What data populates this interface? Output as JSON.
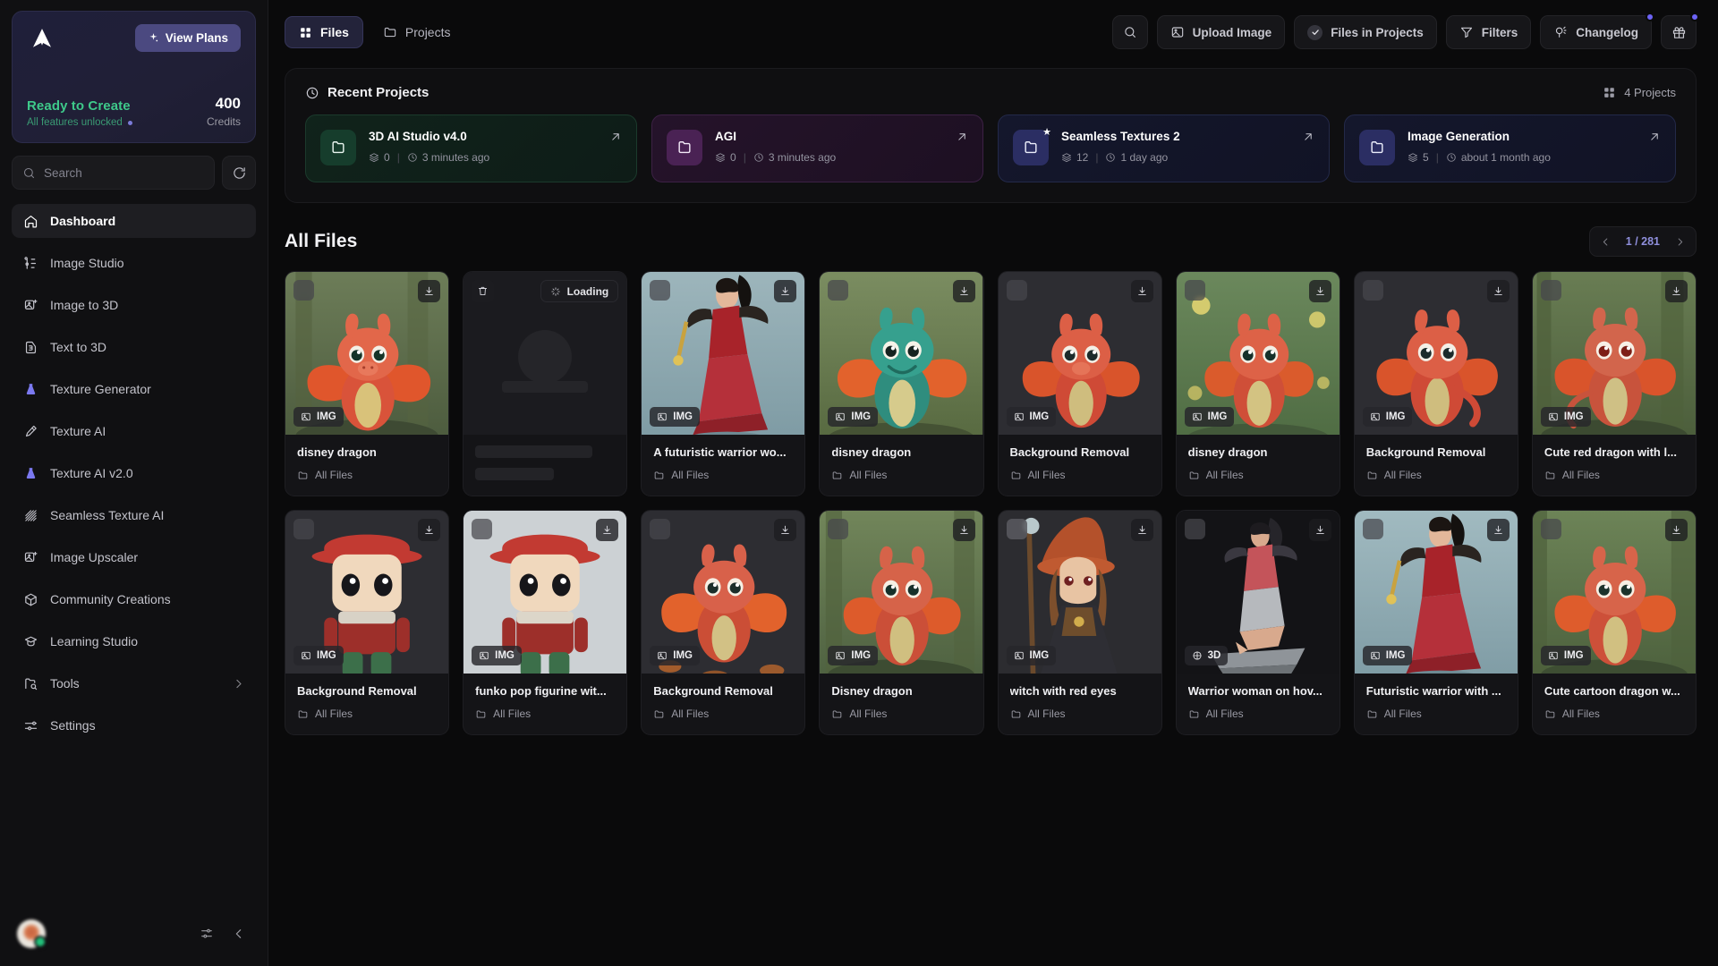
{
  "sidebar": {
    "plan": {
      "view_plans_label": "View Plans",
      "status_title": "Ready to Create",
      "status_sub": "All features unlocked",
      "credits_value": "400",
      "credits_label": "Credits"
    },
    "search_placeholder": "Search",
    "nav_items": [
      {
        "label": "Dashboard",
        "icon": "home-icon",
        "active": true
      },
      {
        "label": "Image Studio",
        "icon": "image-studio-icon",
        "active": false
      },
      {
        "label": "Image to 3D",
        "icon": "image-to-3d-icon",
        "active": false
      },
      {
        "label": "Text to 3D",
        "icon": "text-to-3d-icon",
        "active": false
      },
      {
        "label": "Texture Generator",
        "icon": "texture-generator-icon",
        "active": false
      },
      {
        "label": "Texture AI",
        "icon": "texture-ai-icon",
        "active": false
      },
      {
        "label": "Texture AI v2.0",
        "icon": "texture-ai-v2-icon",
        "active": false
      },
      {
        "label": "Seamless Texture AI",
        "icon": "seamless-texture-icon",
        "active": false
      },
      {
        "label": "Image Upscaler",
        "icon": "image-upscaler-icon",
        "active": false
      },
      {
        "label": "Community Creations",
        "icon": "community-icon",
        "active": false
      },
      {
        "label": "Learning Studio",
        "icon": "learning-icon",
        "active": false
      },
      {
        "label": "Tools",
        "icon": "tools-icon",
        "active": false,
        "chevron": true
      },
      {
        "label": "Settings",
        "icon": "settings-icon",
        "active": false
      }
    ],
    "profile": {
      "name": "",
      "email": ""
    }
  },
  "topbar": {
    "tabs": [
      {
        "label": "Files",
        "icon": "grid-icon",
        "active": true
      },
      {
        "label": "Projects",
        "icon": "folder-icon",
        "active": false
      }
    ],
    "actions": [
      {
        "label": "",
        "icon": "search-icon",
        "icon_only": true,
        "badge": false
      },
      {
        "label": "Upload Image",
        "icon": "image-icon",
        "icon_only": false,
        "badge": false
      },
      {
        "label": "Files in Projects",
        "icon": "check-icon",
        "icon_only": false,
        "badge": false
      },
      {
        "label": "Filters",
        "icon": "funnel-icon",
        "icon_only": false,
        "badge": false
      },
      {
        "label": "Changelog",
        "icon": "megaphone-icon",
        "icon_only": false,
        "badge": true
      },
      {
        "label": "",
        "icon": "gift-icon",
        "icon_only": true,
        "badge": true
      }
    ]
  },
  "recent": {
    "title": "Recent Projects",
    "count_label": "4 Projects",
    "projects": [
      {
        "name": "3D AI Studio v4.0",
        "assets": "0",
        "time": "3 minutes ago",
        "color": "c-green",
        "icon_color": "ico-green",
        "starred": false
      },
      {
        "name": "AGI",
        "assets": "0",
        "time": "3 minutes ago",
        "color": "c-purple",
        "icon_color": "ico-purple",
        "starred": false
      },
      {
        "name": "Seamless Textures 2",
        "assets": "12",
        "time": "1 day ago",
        "color": "c-blue",
        "icon_color": "ico-blue",
        "starred": true
      },
      {
        "name": "Image Generation",
        "assets": "5",
        "time": "about 1 month ago",
        "color": "c-blue",
        "icon_color": "ico-blue",
        "starred": false
      }
    ]
  },
  "files": {
    "title": "All Files",
    "page_label": "1 / 281",
    "folder_label": "All Files",
    "loading_label": "Loading",
    "items": [
      {
        "title": "disney dragon",
        "badge": "IMG",
        "state": "ready",
        "art": "dragon-red-forest"
      },
      {
        "title": "",
        "badge": "",
        "state": "loading",
        "art": ""
      },
      {
        "title": "A futuristic warrior wo...",
        "badge": "IMG",
        "state": "ready",
        "art": "warrior-woman"
      },
      {
        "title": "disney dragon",
        "badge": "IMG",
        "state": "ready",
        "art": "dragon-teal"
      },
      {
        "title": "Background Removal",
        "badge": "IMG",
        "state": "ready",
        "art": "dragon-red-plain"
      },
      {
        "title": "disney dragon",
        "badge": "IMG",
        "state": "ready",
        "art": "dragon-red-flowers"
      },
      {
        "title": "Background Removal",
        "badge": "IMG",
        "state": "ready",
        "art": "dragon-red-plain"
      },
      {
        "title": "Cute red dragon with l...",
        "badge": "IMG",
        "state": "ready",
        "art": "dragon-red-forest"
      },
      {
        "title": "Background Removal",
        "badge": "IMG",
        "state": "ready",
        "art": "funko-boy"
      },
      {
        "title": "funko pop figurine wit...",
        "badge": "IMG",
        "state": "ready",
        "art": "funko-boy-light"
      },
      {
        "title": "Background Removal",
        "badge": "IMG",
        "state": "ready",
        "art": "dragon-red-autumn"
      },
      {
        "title": "Disney dragon",
        "badge": "IMG",
        "state": "ready",
        "art": "dragon-red-forest"
      },
      {
        "title": "witch with red eyes",
        "badge": "IMG",
        "state": "ready",
        "art": "witch"
      },
      {
        "title": "Warrior woman on hov...",
        "badge": "3D",
        "state": "ready",
        "art": "warrior-3d"
      },
      {
        "title": "Futuristic warrior with ...",
        "badge": "IMG",
        "state": "ready",
        "art": "warrior-woman"
      },
      {
        "title": "Cute cartoon dragon w...",
        "badge": "IMG",
        "state": "ready",
        "art": "dragon-red-forest"
      }
    ]
  },
  "colors": {
    "accent": "#6c63f5",
    "green": "#3ec98a",
    "page_bg": "#0a0a0b",
    "sidebar_bg": "#101012",
    "card_bg": "#141417"
  }
}
